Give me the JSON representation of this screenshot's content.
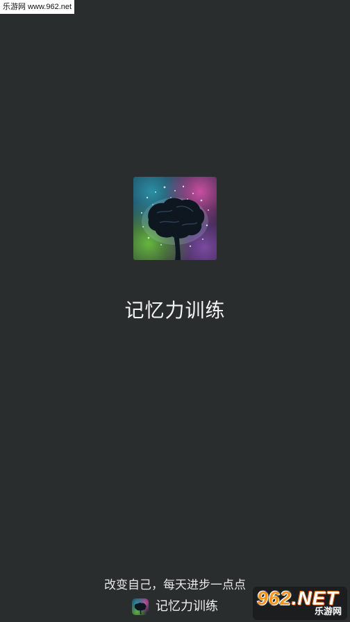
{
  "watermark": {
    "site_label": "乐游网 www.962.net"
  },
  "splash": {
    "app_title": "记忆力训练",
    "icon": "brain-icon",
    "slogan": "改变自己，每天进步一点点"
  },
  "brand": {
    "icon": "brain-app-icon",
    "name": "记忆力训练"
  },
  "corner_watermark": {
    "logo_num": "962",
    "logo_suffix": ".NET",
    "sub": "乐游网"
  },
  "colors": {
    "background": "#2a2d2e",
    "text": "#ffffff",
    "logo_accent": "#f7941e"
  }
}
